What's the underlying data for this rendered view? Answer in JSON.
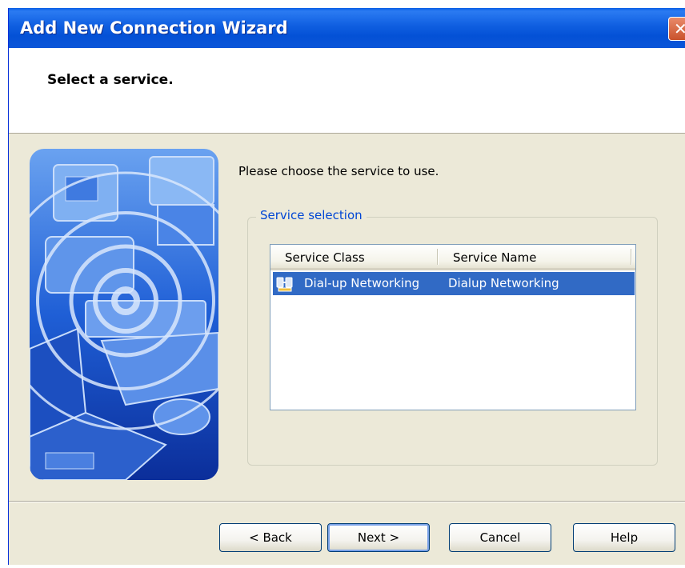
{
  "window": {
    "title": "Add New Connection Wizard"
  },
  "header": {
    "heading": "Select a service."
  },
  "body": {
    "instruction": "Please choose the service to use."
  },
  "service_selection": {
    "legend": "Service selection",
    "columns": [
      "Service Class",
      "Service Name"
    ],
    "rows": [
      {
        "service_class": "Dial-up Networking",
        "service_name": "Dialup Networking",
        "icon": "dialup-networking-icon",
        "selected": true
      }
    ]
  },
  "buttons": {
    "back": "< Back",
    "next": "Next >",
    "cancel": "Cancel",
    "help": "Help"
  },
  "colors": {
    "titlebar": "#0451d6",
    "selection": "#316ac5",
    "legend_text": "#0046d5",
    "dialog_bg": "#ece9d8"
  }
}
